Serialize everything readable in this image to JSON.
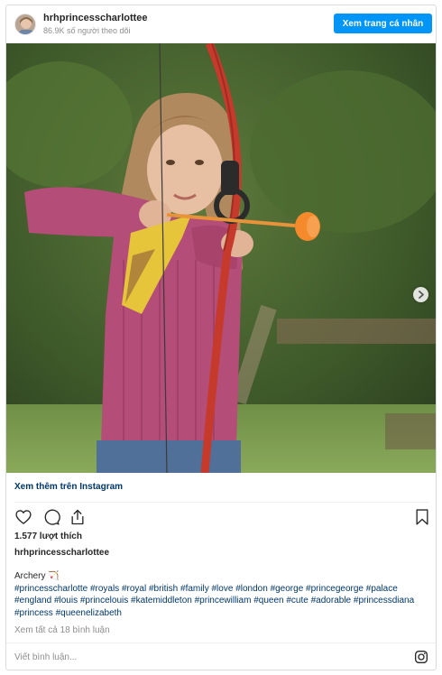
{
  "header": {
    "username": "hrhprincesscharlottee",
    "followers": "86.9K số người theo dõi",
    "profile_button": "Xem trang cá nhân"
  },
  "post": {
    "image": {
      "subject": "Girl in pink sweater and yellow scout scarf drawing a red bow with an orange suction-cup arrow",
      "carousel_position": 1,
      "carousel_count": 2
    },
    "view_more": "Xem thêm trên Instagram",
    "likes": "1.577 lượt thích",
    "caption_user": "hrhprincesscharlottee",
    "caption_title": "Archery 🏹",
    "hashtags": [
      "#princesscharlotte",
      "#royals",
      "#royal",
      "#british",
      "#family",
      "#love",
      "#london",
      "#george",
      "#princegeorge",
      "#palace",
      "#england",
      "#louis",
      "#princelouis",
      "#katemiddleton",
      "#princewilliam",
      "#queen",
      "#cute",
      "#adorable",
      "#princessdiana",
      "#princess",
      "#queenelizabeth"
    ],
    "view_comments": "Xem tất cả 18 bình luận",
    "comment_placeholder": "Viết bình luận..."
  },
  "icons": {
    "like": "heart-icon",
    "comment": "comment-icon",
    "share": "share-icon",
    "save": "bookmark-icon",
    "next": "chevron-right-icon",
    "instagram": "instagram-icon"
  },
  "colors": {
    "accent": "#0095f6",
    "link": "#00376b",
    "muted": "#8e8e8e",
    "text": "#262626"
  }
}
